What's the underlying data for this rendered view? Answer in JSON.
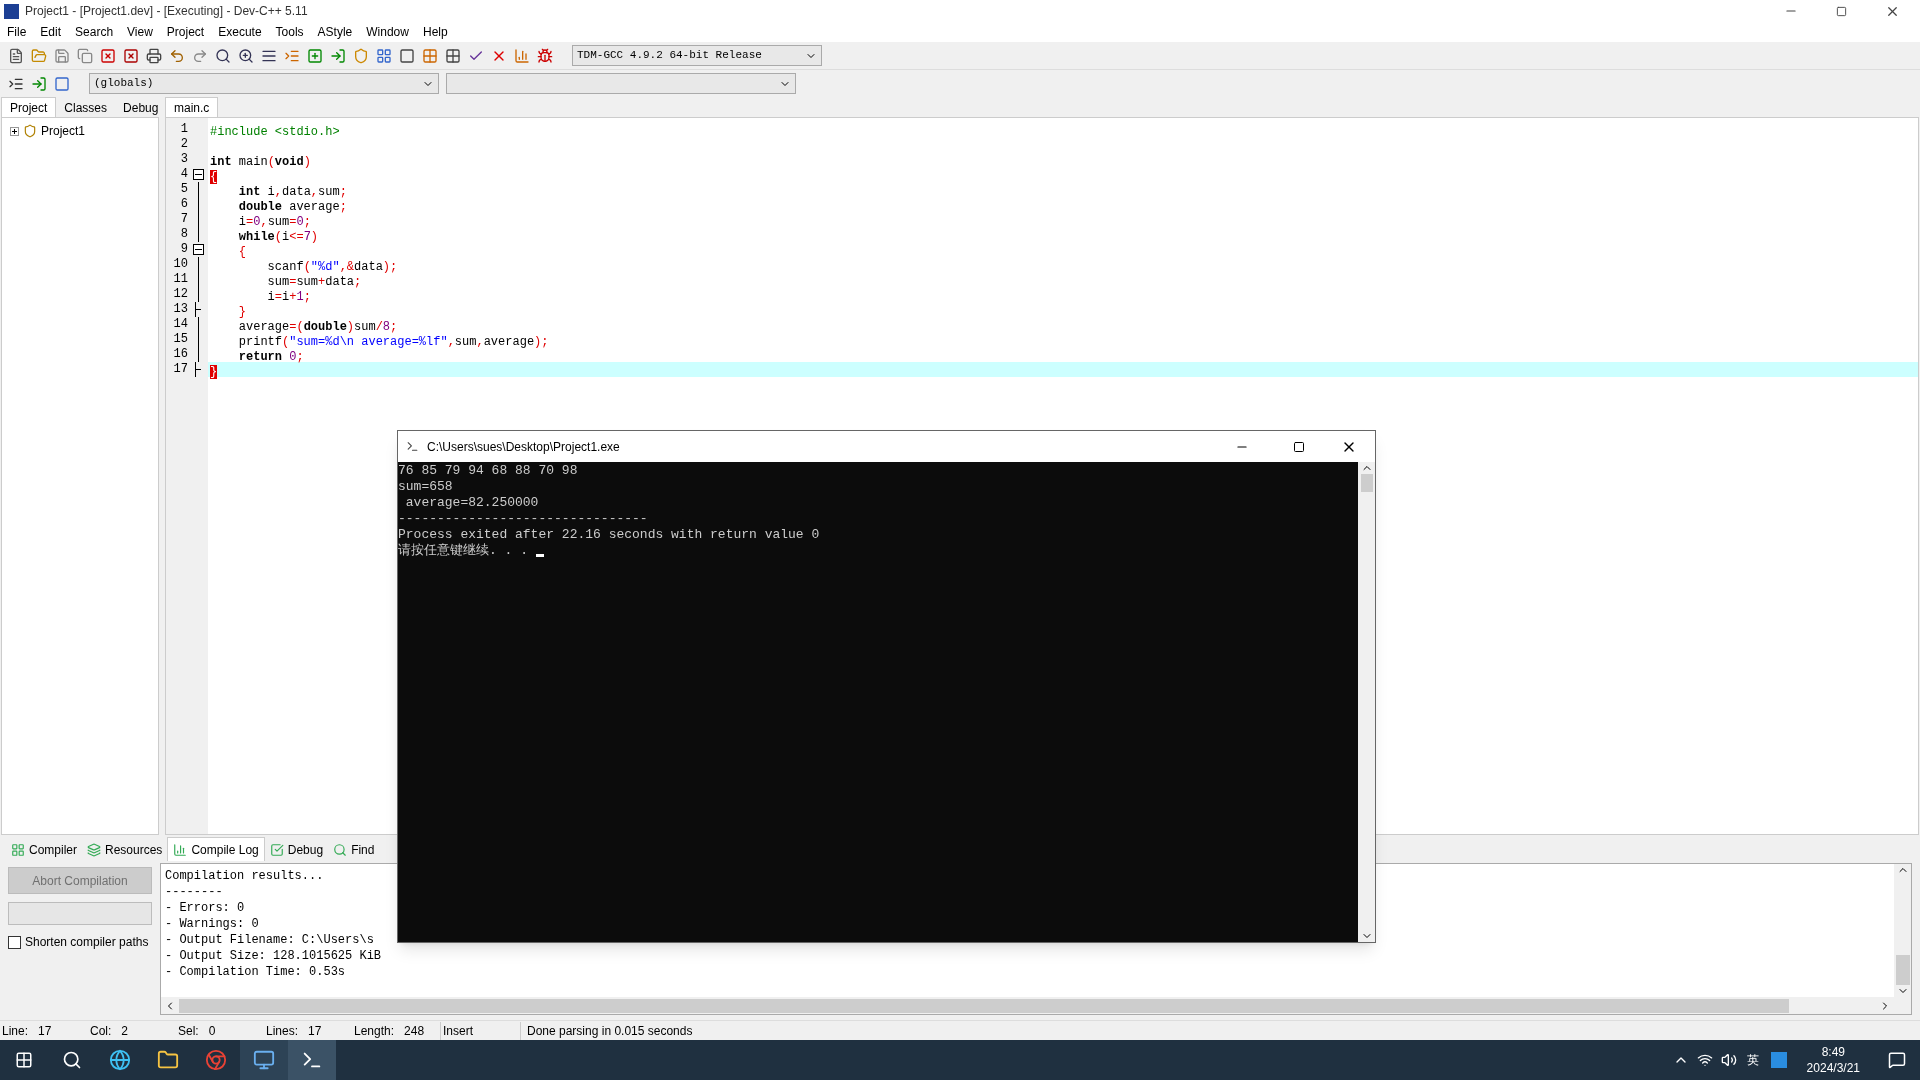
{
  "window": {
    "title": "Project1 - [Project1.dev] - [Executing] - Dev-C++ 5.11"
  },
  "menu": [
    "File",
    "Edit",
    "Search",
    "View",
    "Project",
    "Execute",
    "Tools",
    "AStyle",
    "Window",
    "Help"
  ],
  "toolbar": {
    "compiler_select": "TDM-GCC 4.9.2 64-bit Release",
    "scope_select": "(globals)"
  },
  "left_tabs": [
    {
      "label": "Project",
      "selected": true
    },
    {
      "label": "Classes",
      "selected": false
    },
    {
      "label": "Debug",
      "selected": false
    }
  ],
  "project_tree": [
    {
      "label": "Project1",
      "expanded": false
    }
  ],
  "editor_tabs": [
    {
      "label": "main.c",
      "selected": true
    }
  ],
  "code_lines": [
    {
      "number": "1",
      "kind": "plain",
      "tokens": [
        {
          "text": "#include <stdio.h>",
          "kind": "preproc"
        }
      ]
    },
    {
      "number": "2",
      "kind": "plain"
    },
    {
      "number": "3",
      "kind": "plain",
      "tokens": [
        {
          "text": "int",
          "kind": "keyword"
        },
        {
          "text": " main",
          "kind": "plain"
        },
        {
          "text": "(",
          "kind": "symbol"
        },
        {
          "text": "void",
          "kind": "keyword"
        },
        {
          "text": ")",
          "kind": "symbol"
        }
      ]
    },
    {
      "number": "4",
      "kind": "start",
      "tokens": [
        {
          "text": "{",
          "kind": "brace"
        }
      ]
    },
    {
      "number": "5",
      "kind": "body",
      "tokens": [
        {
          "text": "    int",
          "kind": "keyword"
        },
        {
          "text": " i",
          "kind": "plain"
        },
        {
          "text": ",",
          "kind": "symbol"
        },
        {
          "text": "data",
          "kind": "plain"
        },
        {
          "text": ",",
          "kind": "symbol"
        },
        {
          "text": "sum",
          "kind": "plain"
        },
        {
          "text": ";",
          "kind": "symbol"
        }
      ]
    },
    {
      "number": "6",
      "kind": "body",
      "tokens": [
        {
          "text": "    double",
          "kind": "keyword"
        },
        {
          "text": " average",
          "kind": "plain"
        },
        {
          "text": ";",
          "kind": "symbol"
        }
      ]
    },
    {
      "number": "7",
      "kind": "body",
      "tokens": [
        {
          "text": "    i",
          "kind": "plain"
        },
        {
          "text": "=",
          "kind": "symbol"
        },
        {
          "text": "0",
          "kind": "number"
        },
        {
          "text": ",",
          "kind": "symbol"
        },
        {
          "text": "sum",
          "kind": "plain"
        },
        {
          "text": "=",
          "kind": "symbol"
        },
        {
          "text": "0",
          "kind": "number"
        },
        {
          "text": ";",
          "kind": "symbol"
        }
      ]
    },
    {
      "number": "8",
      "kind": "body",
      "tokens": [
        {
          "text": "    while",
          "kind": "keyword"
        },
        {
          "text": "(",
          "kind": "symbol"
        },
        {
          "text": "i",
          "kind": "plain"
        },
        {
          "text": "<=",
          "kind": "symbol"
        },
        {
          "text": "7",
          "kind": "number"
        },
        {
          "text": ")",
          "kind": "symbol"
        }
      ]
    },
    {
      "number": "9",
      "kind": "start",
      "tokens": [
        {
          "text": "    {",
          "kind": "symbol"
        }
      ]
    },
    {
      "number": "10",
      "kind": "body",
      "tokens": [
        {
          "text": "        scanf",
          "kind": "plain"
        },
        {
          "text": "(",
          "kind": "symbol"
        },
        {
          "text": "\"%d\"",
          "kind": "string"
        },
        {
          "text": ",",
          "kind": "symbol"
        },
        {
          "text": "&",
          "kind": "symbol"
        },
        {
          "text": "data",
          "kind": "plain"
        },
        {
          "text": ")",
          "kind": "symbol"
        },
        {
          "text": ";",
          "kind": "symbol"
        }
      ]
    },
    {
      "number": "11",
      "kind": "body",
      "tokens": [
        {
          "text": "        sum",
          "kind": "plain"
        },
        {
          "text": "=",
          "kind": "symbol"
        },
        {
          "text": "sum",
          "kind": "plain"
        },
        {
          "text": "+",
          "kind": "symbol"
        },
        {
          "text": "data",
          "kind": "plain"
        },
        {
          "text": ";",
          "kind": "symbol"
        }
      ]
    },
    {
      "number": "12",
      "kind": "body",
      "tokens": [
        {
          "text": "        i",
          "kind": "plain"
        },
        {
          "text": "=",
          "kind": "symbol"
        },
        {
          "text": "i",
          "kind": "plain"
        },
        {
          "text": "+",
          "kind": "symbol"
        },
        {
          "text": "1",
          "kind": "number"
        },
        {
          "text": ";",
          "kind": "symbol"
        }
      ]
    },
    {
      "number": "13",
      "kind": "end",
      "tokens": [
        {
          "text": "    }",
          "kind": "symbol"
        }
      ]
    },
    {
      "number": "14",
      "kind": "body",
      "tokens": [
        {
          "text": "    average",
          "kind": "plain"
        },
        {
          "text": "=",
          "kind": "symbol"
        },
        {
          "text": "(",
          "kind": "symbol"
        },
        {
          "text": "double",
          "kind": "keyword"
        },
        {
          "text": ")",
          "kind": "symbol"
        },
        {
          "text": "sum",
          "kind": "plain"
        },
        {
          "text": "/",
          "kind": "symbol"
        },
        {
          "text": "8",
          "kind": "number"
        },
        {
          "text": ";",
          "kind": "symbol"
        }
      ]
    },
    {
      "number": "15",
      "kind": "body",
      "tokens": [
        {
          "text": "    printf",
          "kind": "plain"
        },
        {
          "text": "(",
          "kind": "symbol"
        },
        {
          "text": "\"sum=%d\\n average=%lf\"",
          "kind": "string"
        },
        {
          "text": ",",
          "kind": "symbol"
        },
        {
          "text": "sum",
          "kind": "plain"
        },
        {
          "text": ",",
          "kind": "symbol"
        },
        {
          "text": "average",
          "kind": "plain"
        },
        {
          "text": ")",
          "kind": "symbol"
        },
        {
          "text": ";",
          "kind": "symbol"
        }
      ]
    },
    {
      "number": "16",
      "kind": "body",
      "tokens": [
        {
          "text": "    return",
          "kind": "keyword"
        },
        {
          "text": " 0",
          "kind": "number"
        },
        {
          "text": ";",
          "kind": "symbol"
        }
      ]
    },
    {
      "number": "17",
      "kind": "end",
      "current": true,
      "tokens": [
        {
          "text": "}",
          "kind": "brace"
        }
      ]
    }
  ],
  "bottom_tabs": [
    {
      "label": "Compiler",
      "selected": false
    },
    {
      "label": "Resources",
      "selected": false
    },
    {
      "label": "Compile Log",
      "selected": true
    },
    {
      "label": "Debug",
      "selected": false
    },
    {
      "label": "Find",
      "selected": false
    }
  ],
  "compile_panel": {
    "abort_button": {
      "label": "Abort Compilation",
      "disabled": true
    },
    "shorten_paths": {
      "label": "Shorten compiler paths",
      "checked": false
    },
    "progress": {
      "level": 0
    },
    "log": [
      "Compilation results...",
      "--------",
      "- Errors: 0",
      "- Warnings: 0",
      "- Output Filename: C:\\Users\\s",
      "- Output Size: 128.1015625 KiB",
      "- Compilation Time: 0.53s"
    ]
  },
  "status_bar": [
    {
      "label": "Line:",
      "value": "17"
    },
    {
      "label": "Col:",
      "value": "2"
    },
    {
      "label": "Sel:",
      "value": "0"
    },
    {
      "label": "Lines:",
      "value": "17"
    },
    {
      "label": "Length:",
      "value": "248"
    },
    {
      "value": "Insert"
    },
    {
      "value": "Done parsing in 0.015 seconds"
    }
  ],
  "console": {
    "title": "C:\\Users\\sues\\Desktop\\Project1.exe",
    "lines": [
      "76 85 79 94 68 88 70 98",
      "sum=658",
      " average=82.250000",
      "--------------------------------",
      "Process exited after 22.16 seconds with return value 0",
      "请按任意键继续. . . "
    ]
  },
  "taskbar": {
    "ime": "英",
    "time": "8:49",
    "date": "2024/3/21"
  }
}
